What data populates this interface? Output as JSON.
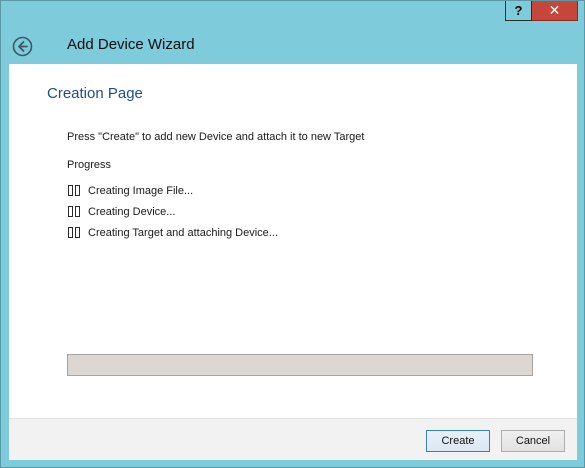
{
  "window": {
    "title": "Add Device Wizard",
    "help_label": "?",
    "close_label": "✕"
  },
  "page": {
    "title": "Creation Page",
    "instruction": "Press \"Create\" to add new Device and attach it to new Target",
    "progress_label": "Progress",
    "steps": [
      {
        "label": "Creating Image File...",
        "icon": "pending-step-icon"
      },
      {
        "label": "Creating Device...",
        "icon": "pending-step-icon"
      },
      {
        "label": "Creating Target and attaching Device...",
        "icon": "pending-step-icon"
      }
    ],
    "progress_fraction": 0
  },
  "footer": {
    "create_label": "Create",
    "cancel_label": "Cancel"
  },
  "colors": {
    "chrome": "#7ecbdc",
    "close_button": "#c7463a",
    "page_title": "#1f4e86",
    "progress_track": "#dcd7d3"
  }
}
